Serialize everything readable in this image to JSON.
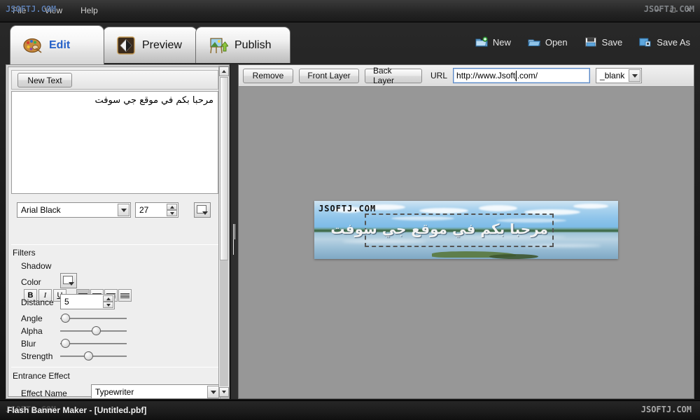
{
  "window": {
    "watermark": "JSOFTJ.COM",
    "menus": [
      "File",
      "View",
      "Help"
    ],
    "controls": [
      "minimize",
      "maximize",
      "close"
    ],
    "control_glyphs": [
      "–",
      "□",
      "✕"
    ]
  },
  "tabs": [
    {
      "label": "Edit",
      "icon": "palette-icon",
      "active": true
    },
    {
      "label": "Preview",
      "icon": "diamond-icon",
      "active": false
    },
    {
      "label": "Publish",
      "icon": "easel-icon",
      "active": false
    }
  ],
  "toolbar": [
    {
      "label": "New",
      "icon": "new-folder-icon"
    },
    {
      "label": "Open",
      "icon": "open-folder-icon"
    },
    {
      "label": "Save",
      "icon": "save-icon"
    },
    {
      "label": "Save As",
      "icon": "save-as-icon"
    }
  ],
  "left_panel": {
    "new_text_button": "New Text",
    "text_content": "مرحبا بكم في موقع جي سوفت",
    "font": {
      "family": "Arial Black",
      "size": "27",
      "color_swatch": "#ffffff",
      "bold_label": "B",
      "italic_label": "I",
      "underline_label": "U",
      "alignments": [
        "align-left",
        "align-center",
        "align-right",
        "align-justify"
      ],
      "selected_alignment": "align-left"
    },
    "filters": {
      "title": "Filters",
      "shadow_label": "Shadow",
      "color_label": "Color",
      "color_value": "#ffffff",
      "distance_label": "Distance",
      "distance_value": "5",
      "sliders": [
        {
          "label": "Angle",
          "percent": 2
        },
        {
          "label": "Alpha",
          "percent": 50
        },
        {
          "label": "Blur",
          "percent": 2
        },
        {
          "label": "Strength",
          "percent": 38
        }
      ]
    },
    "entrance_effect": {
      "title": "Entrance Effect",
      "effect_name_label": "Effect Name",
      "effect_name_value": "Typewriter"
    }
  },
  "editor": {
    "buttons": [
      "Remove",
      "Front Layer",
      "Back Layer"
    ],
    "url_label": "URL",
    "url_value": "http://www.Jsoftj.com/",
    "target_value": "_blank"
  },
  "banner": {
    "watermark": "JSOFTJ.COM",
    "text": "مرحبا بكم في موقع جي سوفت"
  },
  "statusbar": {
    "text": "Flash Banner Maker - [Untitled.pbf]",
    "watermark": "JSOFTJ.COM",
    "watermark_right": "JSOFTJ.COM"
  }
}
